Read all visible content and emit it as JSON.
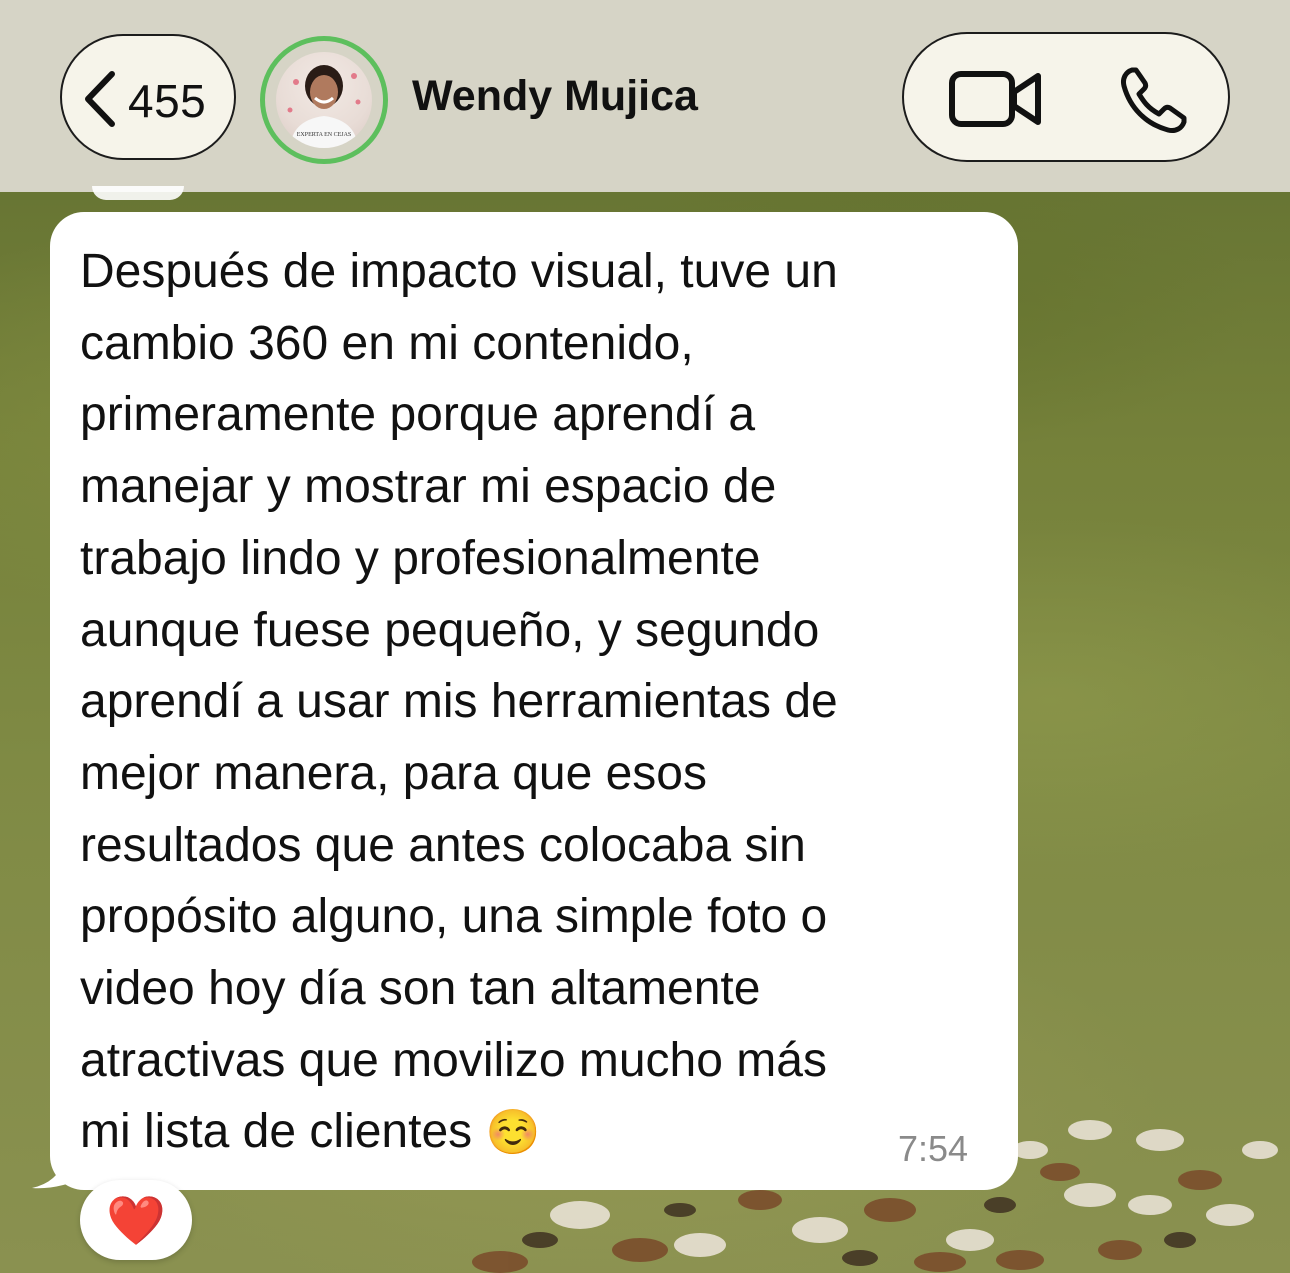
{
  "header": {
    "back_count": "455",
    "contact_name": "Wendy Mujica",
    "avatar_shirt_text": "EXPERTA EN CEJAS",
    "icons": {
      "back": "chevron-left-icon",
      "video": "video-camera-icon",
      "phone": "phone-icon"
    }
  },
  "message": {
    "text": "Después de impacto visual, tuve un\ncambio 360 en mi contenido,\nprimeramente porque aprendí a\nmanejar y mostrar mi espacio de\ntrabajo lindo y profesionalmente\naunque fuese pequeño, y segundo\naprendí a usar mis herramientas de\nmejor manera, para que esos\nresultados que antes colocaba sin\npropósito alguno, una simple foto o\nvideo hoy día son tan altamente\natractivas que movilizo mucho más\nmi lista de clientes ",
    "emoji": "☺️",
    "time": "7:54",
    "reaction": "❤️"
  },
  "colors": {
    "header_bg": "#d6d4c6",
    "avatar_ring": "#5dbf5d",
    "bubble_bg": "#ffffff",
    "time_text": "#8a8a8a"
  }
}
